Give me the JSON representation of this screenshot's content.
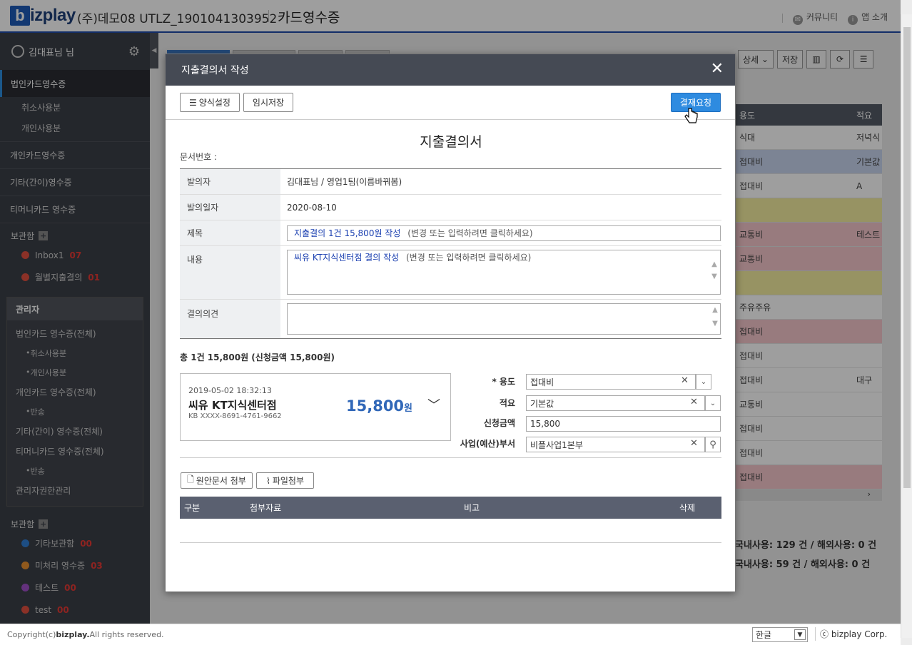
{
  "header": {
    "logo_letter": "b",
    "logo_text": "izplay",
    "company": "(주)데모08 UTLZ_1901041303952",
    "page_title": "카드영수증",
    "links": [
      {
        "icon": "chat-icon",
        "label": "커뮤니티"
      },
      {
        "icon": "info-icon",
        "label": "앱 소개"
      }
    ]
  },
  "sidebar": {
    "user_name": "김대표님 님",
    "active_item": "법인카드영수증",
    "active_subitems": [
      "취소사용분",
      "개인사용분"
    ],
    "items": [
      "개인카드영수증",
      "기타(간이)영수증",
      "티머니카드 영수증"
    ],
    "storage_title": "보관함",
    "storage_folders": [
      {
        "name": "Inbox1",
        "count": "07",
        "color": "#e05040"
      },
      {
        "name": "월별지출결의",
        "count": "01",
        "color": "#e05040"
      }
    ],
    "admin": {
      "title": "관리자",
      "items": [
        {
          "label": "법인카드 영수증(전체)",
          "level": 1
        },
        {
          "label": "취소사용분",
          "level": 2
        },
        {
          "label": "개인사용분",
          "level": 2
        },
        {
          "label": "개인카드 영수증(전체)",
          "level": 1
        },
        {
          "label": "반송",
          "level": 2
        },
        {
          "label": "기타(간이) 영수증(전체)",
          "level": 1
        },
        {
          "label": "티머니카드 영수증(전체)",
          "level": 1
        },
        {
          "label": "반송",
          "level": 2
        },
        {
          "label": "관리자권한관리",
          "level": 1
        }
      ]
    },
    "storage2_title": "보관함",
    "storage2_folders": [
      {
        "name": "기타보관함",
        "count": "00",
        "color": "#2f7fd6"
      },
      {
        "name": "미처리 영수증",
        "count": "03",
        "color": "#e89030"
      },
      {
        "name": "테스트",
        "count": "00",
        "color": "#a050c8"
      },
      {
        "name": "test",
        "count": "00",
        "color": "#e05040"
      }
    ]
  },
  "background": {
    "toolbar": {
      "detail_label": "상세",
      "save_label": "저장"
    },
    "table_headers": [
      "용도",
      "적요"
    ],
    "rows": [
      {
        "c1": "식대",
        "c2": "저녁식",
        "color": "#ffffff"
      },
      {
        "c1": "접대비",
        "c2": "기본값",
        "color": "#c9d6ef"
      },
      {
        "c1": "접대비",
        "c2": "A",
        "color": "#ffffff"
      },
      {
        "c1": "",
        "c2": "",
        "color": "#f4eda0"
      },
      {
        "c1": "교통비",
        "c2": "테스트",
        "color": "#f6c7cc"
      },
      {
        "c1": "교통비",
        "c2": "",
        "color": "#f6c7cc"
      },
      {
        "c1": "",
        "c2": "",
        "color": "#f4eda0"
      },
      {
        "c1": "주유주유",
        "c2": "",
        "color": "#ffffff"
      },
      {
        "c1": "접대비",
        "c2": "",
        "color": "#f6c7cc"
      },
      {
        "c1": "접대비",
        "c2": "",
        "color": "#ffffff"
      },
      {
        "c1": "접대비",
        "c2": "대구",
        "color": "#ffffff"
      },
      {
        "c1": "교통비",
        "c2": "",
        "color": "#ffffff"
      },
      {
        "c1": "접대비",
        "c2": "",
        "color": "#ffffff"
      },
      {
        "c1": "접대비",
        "c2": "",
        "color": "#ffffff"
      },
      {
        "c1": "접대비",
        "c2": "",
        "color": "#f6c7cc"
      }
    ],
    "summary1": "국내사용: 129 건 / 해외사용: 0 건",
    "summary2": "국내사용: 59 건 / 해외사용: 0 건"
  },
  "footer": {
    "copyright_prefix": "Copyright(c) ",
    "copyright_brand": "bizplay.",
    "copyright_suffix": " All rights reserved.",
    "language": "한글",
    "corp": "ⓒ bizplay Corp."
  },
  "modal": {
    "title": "지출결의서 작성",
    "btn_form_settings": "양식설정",
    "btn_temp_save": "임시저장",
    "btn_request": "결재요청",
    "doc_title": "지출결의서",
    "doc_number_label": "문서번호 :",
    "fields": {
      "proposer_label": "발의자",
      "proposer_value": "김대표님 / 영업1팀(이름바꿔봄)",
      "date_label": "발의일자",
      "date_value": "2020-08-10",
      "subject_label": "제목",
      "subject_value": "지출결의 1건 15,800원 작성",
      "subject_hint": "(변경 또는 입력하려면 클릭하세요)",
      "content_label": "내용",
      "content_value": "씨유 KT지식센터점 결의 작성",
      "content_hint": "(변경 또는 입력하려면 클릭하세요)",
      "opinion_label": "결의의견",
      "opinion_value": ""
    },
    "total_line": "총 1건 15,800원 (신청금액 15,800원)",
    "card": {
      "datetime": "2019-05-02 18:32:13",
      "merchant": "씨유 KT지식센터점",
      "card_number": "KB XXXX-8691-4761-9662",
      "amount": "15,800",
      "currency": "원"
    },
    "right_fields": {
      "usage_label": "* 용도",
      "usage_value": "접대비",
      "memo_label": "적요",
      "memo_value": "기본값",
      "request_amount_label": "신청금액",
      "request_amount_value": "15,800",
      "dept_label": "사업(예산)부서",
      "dept_value": "비플사업1본부"
    },
    "attach_original_label": "원안문서 첨부",
    "attach_file_label": "파일첨부",
    "attach_headers": [
      "구분",
      "첨부자료",
      "비고",
      "삭제"
    ]
  }
}
